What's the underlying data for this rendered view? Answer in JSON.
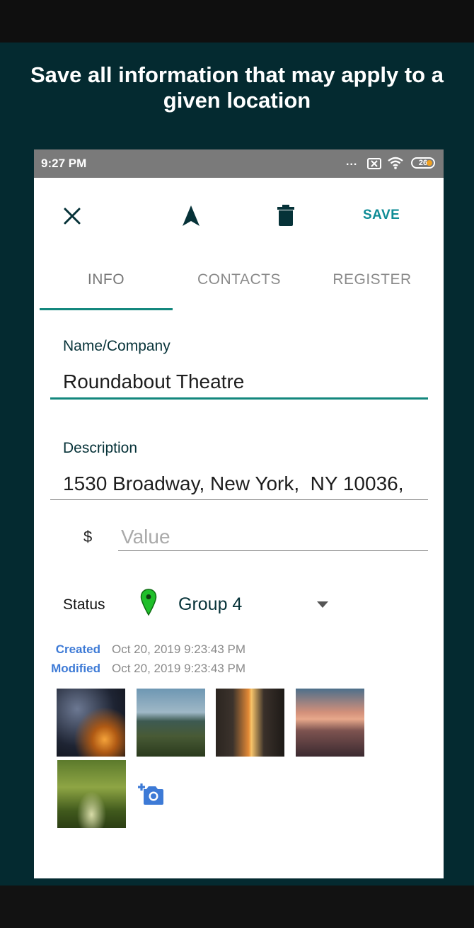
{
  "banner": {
    "headline": "Save all information that may apply to a given location"
  },
  "statusbar": {
    "time": "9:27 PM",
    "dots": "...",
    "battery": "26"
  },
  "toolbar": {
    "close_icon": "close-icon",
    "navigate_icon": "navigation-arrow-icon",
    "delete_icon": "trash-icon",
    "save_label": "SAVE"
  },
  "tabs": [
    {
      "label": "INFO",
      "active": true
    },
    {
      "label": "CONTACTS",
      "active": false
    },
    {
      "label": "REGISTER",
      "active": false
    }
  ],
  "form": {
    "name": {
      "label": "Name/Company",
      "value": "Roundabout Theatre"
    },
    "description": {
      "label": "Description",
      "value": "1530 Broadway, New York,  NY 10036,"
    },
    "value": {
      "currency": "$",
      "placeholder": "Value",
      "value": ""
    },
    "status": {
      "label": "Status",
      "group": "Group 4",
      "pin_color": "#1fbf2a"
    }
  },
  "meta": {
    "created_label": "Created",
    "created_value": "Oct 20, 2019 9:23:43 PM",
    "modified_label": "Modified",
    "modified_value": "Oct 20, 2019 9:23:43 PM"
  },
  "photos": {
    "count": 5,
    "add_icon": "add-photo-camera-icon"
  },
  "colors": {
    "accent": "#13877d",
    "save": "#0f8c96",
    "meta_label": "#3d7ad6",
    "banner_bg": "#042a30"
  }
}
